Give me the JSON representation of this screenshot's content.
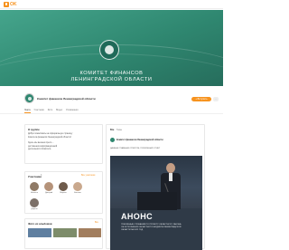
{
  "app": {
    "logo_text": "OK"
  },
  "cover": {
    "title_line1": "КОМИТЕТ ФИНАНСОВ",
    "title_line2": "ЛЕНИНГРАДСКОЙ ОБЛАСТИ",
    "bg_color": "#2f8770"
  },
  "group": {
    "name": "Комитет финансов Ленинградской области",
    "join_label": "+ Вступить",
    "more_label": "…"
  },
  "tabs": [
    "Лента",
    "Участники",
    "Фото",
    "Видео",
    "Упоминания"
  ],
  "about": {
    "title": "О группе",
    "line1": "Добро пожаловать на официальную страницу",
    "line2": "Комитета финансов Ленинградской области!",
    "line3": "Здесь мы вешаем пресс-...",
    "line4": "достижения информационной",
    "line5": "деятельности Комитета"
  },
  "members": {
    "title": "Участники",
    "count": "8",
    "all_label": "Все участники",
    "people": [
      {
        "name": "Наталья"
      },
      {
        "name": "Дмитрий"
      },
      {
        "name": "Марина"
      },
      {
        "name": "Евгения"
      },
      {
        "name": "Дарина"
      }
    ]
  },
  "photos": {
    "title": "Фото из альбомов",
    "all_label": "Все"
  },
  "feed": {
    "tabs": [
      "Все",
      "Темы"
    ],
    "post_author": "Комитет финансов Ленинградской области",
    "post_text": "ДАННЫЕ ГЛАВНЫМ ОТВЕТОМ, ПУБЛИЧНЫЙ ОТЧЕТ",
    "card_title": "АНОНС",
    "card_text_l1": "ПУБЛИЧНЫЕ СЛУШАНИЯ ПО ПРОЕКТУ ОБЛАСТНОГО ЗАКОНА",
    "card_text_l2": "ОБ ИСПОЛНЕНИИ ОБЛАСТНОГО БЮДЖЕТА ЛЕНИНГРАДСКОЙ",
    "card_text_l3": "ОБЛАСТИ ЗА 2022 ГОД"
  },
  "colors": {
    "accent": "#f7931e",
    "brand": "#2f8770"
  }
}
